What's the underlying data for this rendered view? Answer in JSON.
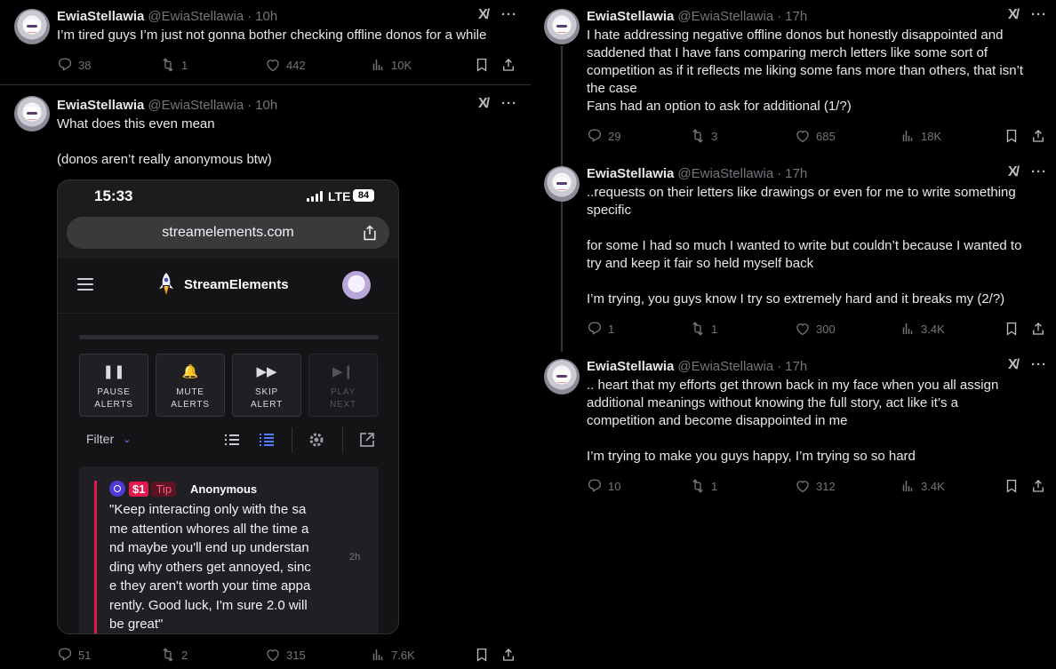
{
  "author": {
    "name": "EwiaStellawia",
    "handle": "@EwiaStellawia",
    "dot": "·"
  },
  "more_glyph": "···",
  "grok_glyph": "X/",
  "tweets": [
    {
      "time": "10h",
      "text": "I’m tired guys I’m just not gonna bother checking offline donos for a while",
      "stats": {
        "replies": "38",
        "reposts": "1",
        "likes": "442",
        "views": "10K"
      }
    },
    {
      "time": "10h",
      "text": "What does this even mean\n\n(donos aren’t really anonymous btw)",
      "stats": {
        "replies": "51",
        "reposts": "2",
        "likes": "315",
        "views": "7.6K"
      },
      "attachment": {
        "clock": "15:33",
        "network": "LTE",
        "battery": "84",
        "url": "streamelements.com",
        "brand": "StreamElements",
        "controls": [
          {
            "label": "PAUSE\nALERTS",
            "symbol": "❚❚",
            "enabled": true
          },
          {
            "label": "MUTE\nALERTS",
            "symbol": "🔔",
            "enabled": true
          },
          {
            "label": "SKIP\nALERT",
            "symbol": "▶▶",
            "enabled": true
          },
          {
            "label": "PLAY\nNEXT",
            "symbol": "▶❙",
            "enabled": false
          }
        ],
        "filter_label": "Filter",
        "filter_chevron": "⌄",
        "event": {
          "amount": "$1",
          "type": "Tip",
          "from": "Anonymous",
          "message": "\"Keep interacting only with the sa\nme attention whores all the time a\nnd maybe you'll end up understan\nding why others get annoyed, sinc\ne they aren't worth your time appa\nrently. Good luck, I'm sure 2.0 will\nbe great\"",
          "ago": "2h"
        }
      }
    },
    {
      "time": "17h",
      "text": "I hate addressing negative offline donos but honestly disappointed and\nsaddened that I have fans comparing merch letters like some sort of\ncompetition as if it reflects me liking some fans more than others, that isn’t\nthe case\nFans had an option to ask for additional (1/?)",
      "stats": {
        "replies": "29",
        "reposts": "3",
        "likes": "685",
        "views": "18K"
      }
    },
    {
      "time": "17h",
      "text": "..requests on their letters like drawings or even for me to write something\nspecific\n\nfor some I had so much I wanted to write but couldn’t because I wanted to\ntry and keep it fair so held myself back\n\nI’m trying, you guys know I try so extremely hard and it breaks my (2/?)",
      "stats": {
        "replies": "1",
        "reposts": "1",
        "likes": "300",
        "views": "3.4K"
      }
    },
    {
      "time": "17h",
      "text": ".. heart that my efforts get thrown back in my face when you all assign\nadditional meanings without knowing the full story, act like it’s a\ncompetition and become disappointed in me\n\nI’m trying to make you guys happy, I’m trying so so hard",
      "stats": {
        "replies": "10",
        "reposts": "1",
        "likes": "312",
        "views": "3.4K"
      }
    }
  ]
}
